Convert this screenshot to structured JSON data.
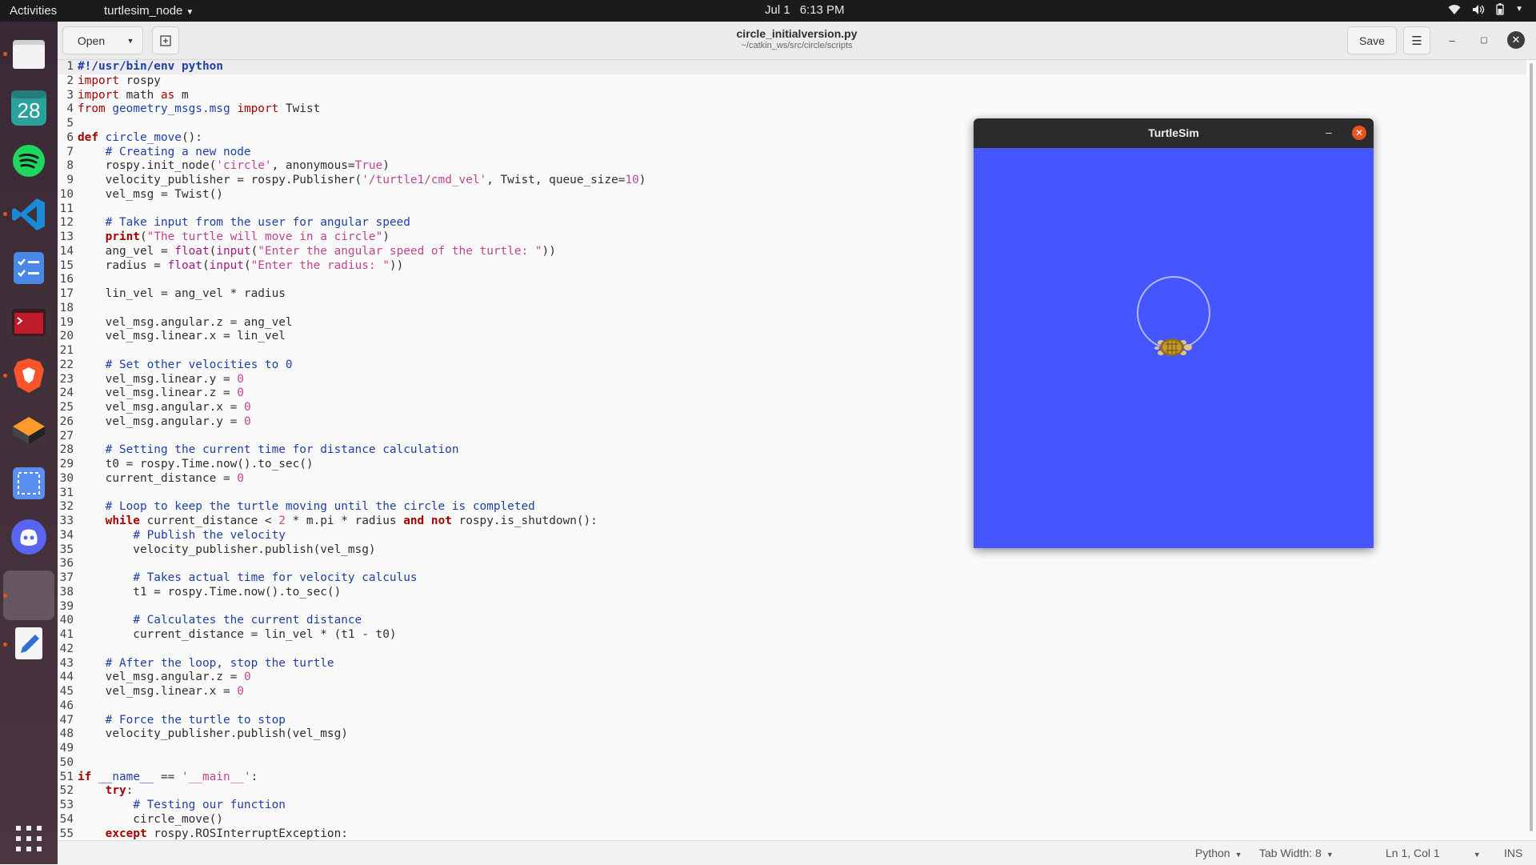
{
  "topbar": {
    "activities": "Activities",
    "app_menu": "turtlesim_node",
    "date": "Jul 1",
    "time": "6:13 PM"
  },
  "dock": {
    "items": [
      "files-icon",
      "calendar-icon",
      "spotify-icon",
      "vscode-icon",
      "tasks-icon",
      "terminal-icon",
      "brave-icon",
      "sublime-icon",
      "screenshot-icon",
      "discord-icon",
      "active-app-icon",
      "text-editor-icon"
    ],
    "calendar_day": "28"
  },
  "editor": {
    "open_label": "Open",
    "filename": "circle_initialversion.py",
    "path": "~/catkin_ws/src/circle/scripts",
    "save_label": "Save"
  },
  "code_lines": [
    "#!/usr/bin/env python",
    "import rospy",
    "import math as m",
    "from geometry_msgs.msg import Twist",
    "",
    "def circle_move():",
    "    # Creating a new node",
    "    rospy.init_node('circle', anonymous=True)",
    "    velocity_publisher = rospy.Publisher('/turtle1/cmd_vel', Twist, queue_size=10)",
    "    vel_msg = Twist()",
    "",
    "    # Take input from the user for angular speed",
    "    print(\"The turtle will move in a circle\")",
    "    ang_vel = float(input(\"Enter the angular speed of the turtle: \"))",
    "    radius = float(input(\"Enter the radius: \"))",
    "",
    "    lin_vel = ang_vel * radius",
    "",
    "    vel_msg.angular.z = ang_vel",
    "    vel_msg.linear.x = lin_vel",
    "",
    "    # Set other velocities to 0",
    "    vel_msg.linear.y = 0",
    "    vel_msg.linear.z = 0",
    "    vel_msg.angular.x = 0",
    "    vel_msg.angular.y = 0",
    "",
    "    # Setting the current time for distance calculation",
    "    t0 = rospy.Time.now().to_sec()",
    "    current_distance = 0",
    "",
    "    # Loop to keep the turtle moving until the circle is completed",
    "    while current_distance < 2 * m.pi * radius and not rospy.is_shutdown():",
    "        # Publish the velocity",
    "        velocity_publisher.publish(vel_msg)",
    "",
    "        # Takes actual time for velocity calculus",
    "        t1 = rospy.Time.now().to_sec()",
    "",
    "        # Calculates the current distance",
    "        current_distance = lin_vel * (t1 - t0)",
    "",
    "    # After the loop, stop the turtle",
    "    vel_msg.angular.z = 0",
    "    vel_msg.linear.x = 0",
    "",
    "    # Force the turtle to stop",
    "    velocity_publisher.publish(vel_msg)",
    "",
    "",
    "if __name__ == '__main__':",
    "    try:",
    "        # Testing our function",
    "        circle_move()",
    "    except rospy.ROSInterruptException:"
  ],
  "statusbar": {
    "language": "Python",
    "tab_width": "Tab Width: 8",
    "position": "Ln 1, Col 1",
    "mode": "INS"
  },
  "turtlesim": {
    "title": "TurtleSim",
    "background_color": "#4556ff",
    "pen_color": "#b3b8ff"
  },
  "colors": {
    "accent": "#e95420"
  }
}
